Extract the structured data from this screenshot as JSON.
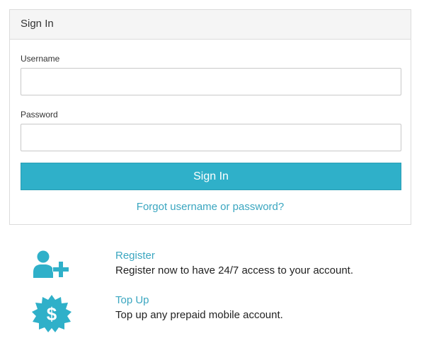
{
  "colors": {
    "accent": "#2fb0c9",
    "link": "#3aa6c0"
  },
  "signin_panel": {
    "title": "Sign In",
    "username_label": "Username",
    "username_value": "",
    "password_label": "Password",
    "password_value": "",
    "submit_label": "Sign In",
    "forgot_link": "Forgot username or password?"
  },
  "features": [
    {
      "icon": "add-user-icon",
      "title": "Register",
      "description": "Register now to have 24/7 access to your account."
    },
    {
      "icon": "dollar-badge-icon",
      "title": "Top Up",
      "description": "Top up any prepaid mobile account."
    }
  ]
}
